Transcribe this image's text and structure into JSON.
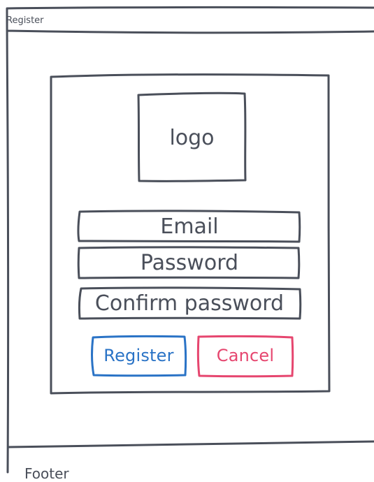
{
  "window": {
    "title": "Register"
  },
  "card": {
    "logo_label": "logo",
    "fields": {
      "email_label": "Email",
      "password_label": "Password",
      "confirm_password_label": "Confirm password"
    },
    "buttons": {
      "register_label": "Register",
      "cancel_label": "Cancel"
    }
  },
  "footer": {
    "label": "Footer"
  },
  "colors": {
    "stroke": "#4a4f5a",
    "register": "#2a73c6",
    "cancel": "#e6466f"
  }
}
